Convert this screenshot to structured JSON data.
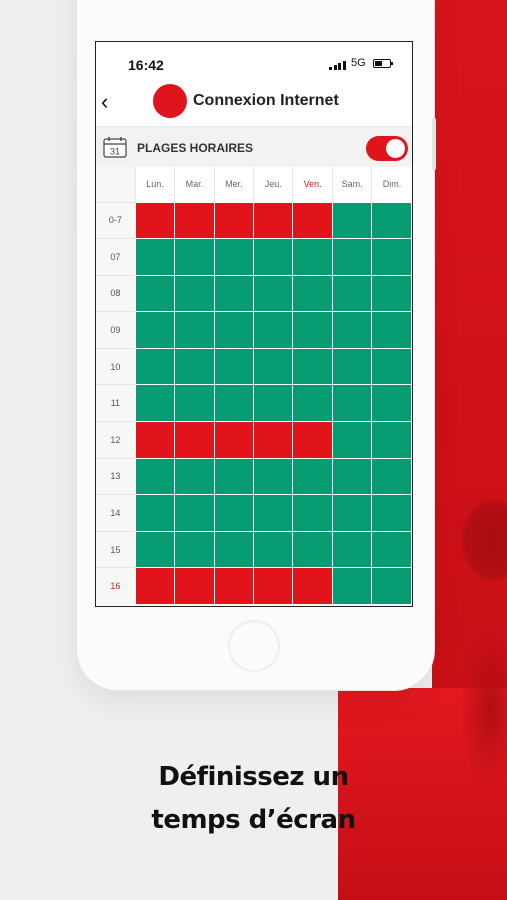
{
  "status_bar": {
    "time": "16:42",
    "network": "5G"
  },
  "header": {
    "title": "Connexion Internet",
    "back_icon": "chevron-left-icon"
  },
  "section": {
    "title": "PLAGES HORAIRES",
    "calendar_day": "31",
    "toggle_on": true
  },
  "days": [
    {
      "label": "Lun.",
      "active": false
    },
    {
      "label": "Mar.",
      "active": false
    },
    {
      "label": "Mer.",
      "active": false
    },
    {
      "label": "Jeu.",
      "active": false
    },
    {
      "label": "Ven.",
      "active": true
    },
    {
      "label": "Sam.",
      "active": false
    },
    {
      "label": "Dim.",
      "active": false
    }
  ],
  "rows": [
    {
      "hour": "0-7",
      "active": false,
      "cells": [
        0,
        0,
        0,
        0,
        0,
        1,
        1
      ]
    },
    {
      "hour": "07",
      "active": false,
      "cells": [
        1,
        1,
        1,
        1,
        1,
        1,
        1
      ]
    },
    {
      "hour": "08",
      "active": false,
      "cells": [
        1,
        1,
        1,
        1,
        1,
        1,
        1
      ]
    },
    {
      "hour": "09",
      "active": false,
      "cells": [
        1,
        1,
        1,
        1,
        1,
        1,
        1
      ]
    },
    {
      "hour": "10",
      "active": false,
      "cells": [
        1,
        1,
        1,
        1,
        1,
        1,
        1
      ]
    },
    {
      "hour": "11",
      "active": false,
      "cells": [
        1,
        1,
        1,
        1,
        1,
        1,
        1
      ]
    },
    {
      "hour": "12",
      "active": false,
      "cells": [
        0,
        0,
        0,
        0,
        0,
        1,
        1
      ]
    },
    {
      "hour": "13",
      "active": false,
      "cells": [
        1,
        1,
        1,
        1,
        1,
        1,
        1
      ]
    },
    {
      "hour": "14",
      "active": false,
      "cells": [
        1,
        1,
        1,
        1,
        1,
        1,
        1
      ]
    },
    {
      "hour": "15",
      "active": false,
      "cells": [
        1,
        1,
        1,
        1,
        1,
        1,
        1
      ]
    },
    {
      "hour": "16",
      "active": true,
      "cells": [
        0,
        0,
        0,
        0,
        0,
        1,
        1
      ]
    }
  ],
  "colors": {
    "allowed": "#069b70",
    "blocked": "#e1141c",
    "accent": "#e1141c"
  },
  "caption": {
    "line1": "Définissez un",
    "line2": "temps d’écran"
  }
}
